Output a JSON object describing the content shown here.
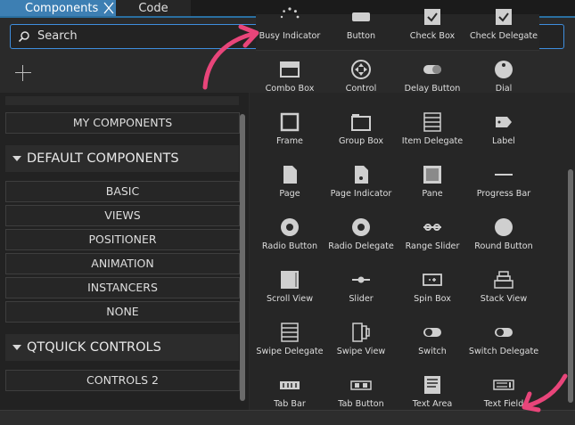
{
  "tabs": [
    {
      "label": "Components",
      "active": true,
      "closable": true
    },
    {
      "label": "Code",
      "active": false
    }
  ],
  "search": {
    "placeholder": "Search",
    "value": ""
  },
  "left_panel": {
    "my_components_label": "MY COMPONENTS",
    "default_components_header": "DEFAULT COMPONENTS",
    "default_items": [
      "BASIC",
      "VIEWS",
      "POSITIONER",
      "ANIMATION",
      "INSTANCERS",
      "NONE"
    ],
    "qtquick_controls_header": "QTQUICK CONTROLS",
    "qtquick_items": [
      "CONTROLS 2"
    ]
  },
  "top_row": [
    {
      "name": "Busy Indicator",
      "icon": "busy-indicator-icon"
    },
    {
      "name": "Button",
      "icon": "button-icon"
    },
    {
      "name": "Check Box",
      "icon": "check-box-icon"
    },
    {
      "name": "Check Delegate",
      "icon": "check-delegate-icon"
    }
  ],
  "components": [
    {
      "name": "Combo Box",
      "icon": "combo-box-icon"
    },
    {
      "name": "Control",
      "icon": "control-icon"
    },
    {
      "name": "Delay Button",
      "icon": "delay-button-icon"
    },
    {
      "name": "Dial",
      "icon": "dial-icon"
    },
    {
      "name": "Frame",
      "icon": "frame-icon"
    },
    {
      "name": "Group Box",
      "icon": "group-box-icon"
    },
    {
      "name": "Item Delegate",
      "icon": "item-delegate-icon"
    },
    {
      "name": "Label",
      "icon": "label-icon"
    },
    {
      "name": "Page",
      "icon": "page-icon"
    },
    {
      "name": "Page Indicator",
      "icon": "page-indicator-icon"
    },
    {
      "name": "Pane",
      "icon": "pane-icon"
    },
    {
      "name": "Progress Bar",
      "icon": "progress-bar-icon"
    },
    {
      "name": "Radio Button",
      "icon": "radio-button-icon"
    },
    {
      "name": "Radio Delegate",
      "icon": "radio-delegate-icon"
    },
    {
      "name": "Range Slider",
      "icon": "range-slider-icon"
    },
    {
      "name": "Round Button",
      "icon": "round-button-icon"
    },
    {
      "name": "Scroll View",
      "icon": "scroll-view-icon"
    },
    {
      "name": "Slider",
      "icon": "slider-icon"
    },
    {
      "name": "Spin Box",
      "icon": "spin-box-icon"
    },
    {
      "name": "Stack View",
      "icon": "stack-view-icon"
    },
    {
      "name": "Swipe Delegate",
      "icon": "swipe-delegate-icon"
    },
    {
      "name": "Swipe View",
      "icon": "swipe-view-icon"
    },
    {
      "name": "Switch",
      "icon": "switch-icon"
    },
    {
      "name": "Switch Delegate",
      "icon": "switch-delegate-icon"
    },
    {
      "name": "Tab Bar",
      "icon": "tab-bar-icon"
    },
    {
      "name": "Tab Button",
      "icon": "tab-button-icon"
    },
    {
      "name": "Text Area",
      "icon": "text-area-icon"
    },
    {
      "name": "Text Field",
      "icon": "text-field-icon"
    }
  ],
  "colors": {
    "accent": "#3d7fb3",
    "annotation_arrow": "#e8457a",
    "background": "#2a2a2a"
  }
}
